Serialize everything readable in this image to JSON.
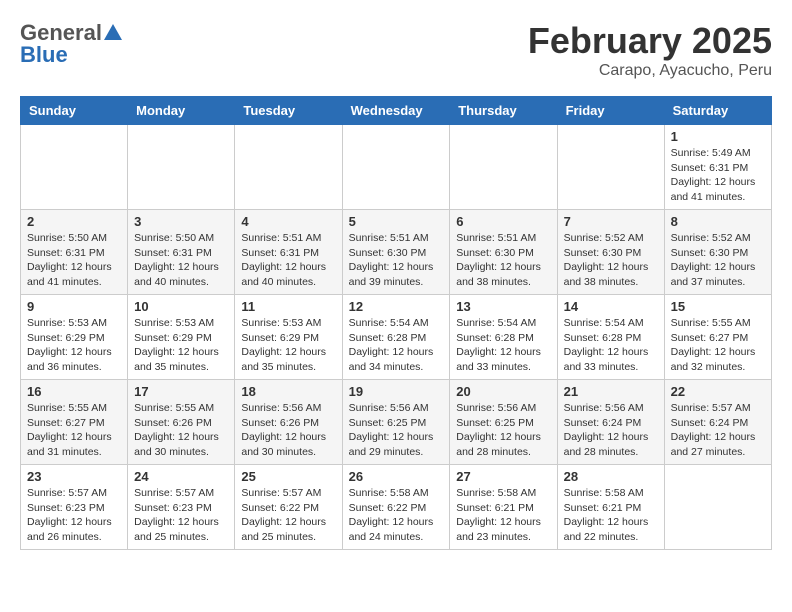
{
  "header": {
    "logo_general": "General",
    "logo_blue": "Blue",
    "month_title": "February 2025",
    "location": "Carapo, Ayacucho, Peru"
  },
  "days_of_week": [
    "Sunday",
    "Monday",
    "Tuesday",
    "Wednesday",
    "Thursday",
    "Friday",
    "Saturday"
  ],
  "weeks": [
    [
      null,
      null,
      null,
      null,
      null,
      null,
      {
        "day": "1",
        "sunrise": "5:49 AM",
        "sunset": "6:31 PM",
        "daylight": "12 hours and 41 minutes."
      }
    ],
    [
      {
        "day": "2",
        "sunrise": "5:50 AM",
        "sunset": "6:31 PM",
        "daylight": "12 hours and 41 minutes."
      },
      {
        "day": "3",
        "sunrise": "5:50 AM",
        "sunset": "6:31 PM",
        "daylight": "12 hours and 40 minutes."
      },
      {
        "day": "4",
        "sunrise": "5:51 AM",
        "sunset": "6:31 PM",
        "daylight": "12 hours and 40 minutes."
      },
      {
        "day": "5",
        "sunrise": "5:51 AM",
        "sunset": "6:30 PM",
        "daylight": "12 hours and 39 minutes."
      },
      {
        "day": "6",
        "sunrise": "5:51 AM",
        "sunset": "6:30 PM",
        "daylight": "12 hours and 38 minutes."
      },
      {
        "day": "7",
        "sunrise": "5:52 AM",
        "sunset": "6:30 PM",
        "daylight": "12 hours and 38 minutes."
      },
      {
        "day": "8",
        "sunrise": "5:52 AM",
        "sunset": "6:30 PM",
        "daylight": "12 hours and 37 minutes."
      }
    ],
    [
      {
        "day": "9",
        "sunrise": "5:53 AM",
        "sunset": "6:29 PM",
        "daylight": "12 hours and 36 minutes."
      },
      {
        "day": "10",
        "sunrise": "5:53 AM",
        "sunset": "6:29 PM",
        "daylight": "12 hours and 35 minutes."
      },
      {
        "day": "11",
        "sunrise": "5:53 AM",
        "sunset": "6:29 PM",
        "daylight": "12 hours and 35 minutes."
      },
      {
        "day": "12",
        "sunrise": "5:54 AM",
        "sunset": "6:28 PM",
        "daylight": "12 hours and 34 minutes."
      },
      {
        "day": "13",
        "sunrise": "5:54 AM",
        "sunset": "6:28 PM",
        "daylight": "12 hours and 33 minutes."
      },
      {
        "day": "14",
        "sunrise": "5:54 AM",
        "sunset": "6:28 PM",
        "daylight": "12 hours and 33 minutes."
      },
      {
        "day": "15",
        "sunrise": "5:55 AM",
        "sunset": "6:27 PM",
        "daylight": "12 hours and 32 minutes."
      }
    ],
    [
      {
        "day": "16",
        "sunrise": "5:55 AM",
        "sunset": "6:27 PM",
        "daylight": "12 hours and 31 minutes."
      },
      {
        "day": "17",
        "sunrise": "5:55 AM",
        "sunset": "6:26 PM",
        "daylight": "12 hours and 30 minutes."
      },
      {
        "day": "18",
        "sunrise": "5:56 AM",
        "sunset": "6:26 PM",
        "daylight": "12 hours and 30 minutes."
      },
      {
        "day": "19",
        "sunrise": "5:56 AM",
        "sunset": "6:25 PM",
        "daylight": "12 hours and 29 minutes."
      },
      {
        "day": "20",
        "sunrise": "5:56 AM",
        "sunset": "6:25 PM",
        "daylight": "12 hours and 28 minutes."
      },
      {
        "day": "21",
        "sunrise": "5:56 AM",
        "sunset": "6:24 PM",
        "daylight": "12 hours and 28 minutes."
      },
      {
        "day": "22",
        "sunrise": "5:57 AM",
        "sunset": "6:24 PM",
        "daylight": "12 hours and 27 minutes."
      }
    ],
    [
      {
        "day": "23",
        "sunrise": "5:57 AM",
        "sunset": "6:23 PM",
        "daylight": "12 hours and 26 minutes."
      },
      {
        "day": "24",
        "sunrise": "5:57 AM",
        "sunset": "6:23 PM",
        "daylight": "12 hours and 25 minutes."
      },
      {
        "day": "25",
        "sunrise": "5:57 AM",
        "sunset": "6:22 PM",
        "daylight": "12 hours and 25 minutes."
      },
      {
        "day": "26",
        "sunrise": "5:58 AM",
        "sunset": "6:22 PM",
        "daylight": "12 hours and 24 minutes."
      },
      {
        "day": "27",
        "sunrise": "5:58 AM",
        "sunset": "6:21 PM",
        "daylight": "12 hours and 23 minutes."
      },
      {
        "day": "28",
        "sunrise": "5:58 AM",
        "sunset": "6:21 PM",
        "daylight": "12 hours and 22 minutes."
      },
      null
    ]
  ]
}
